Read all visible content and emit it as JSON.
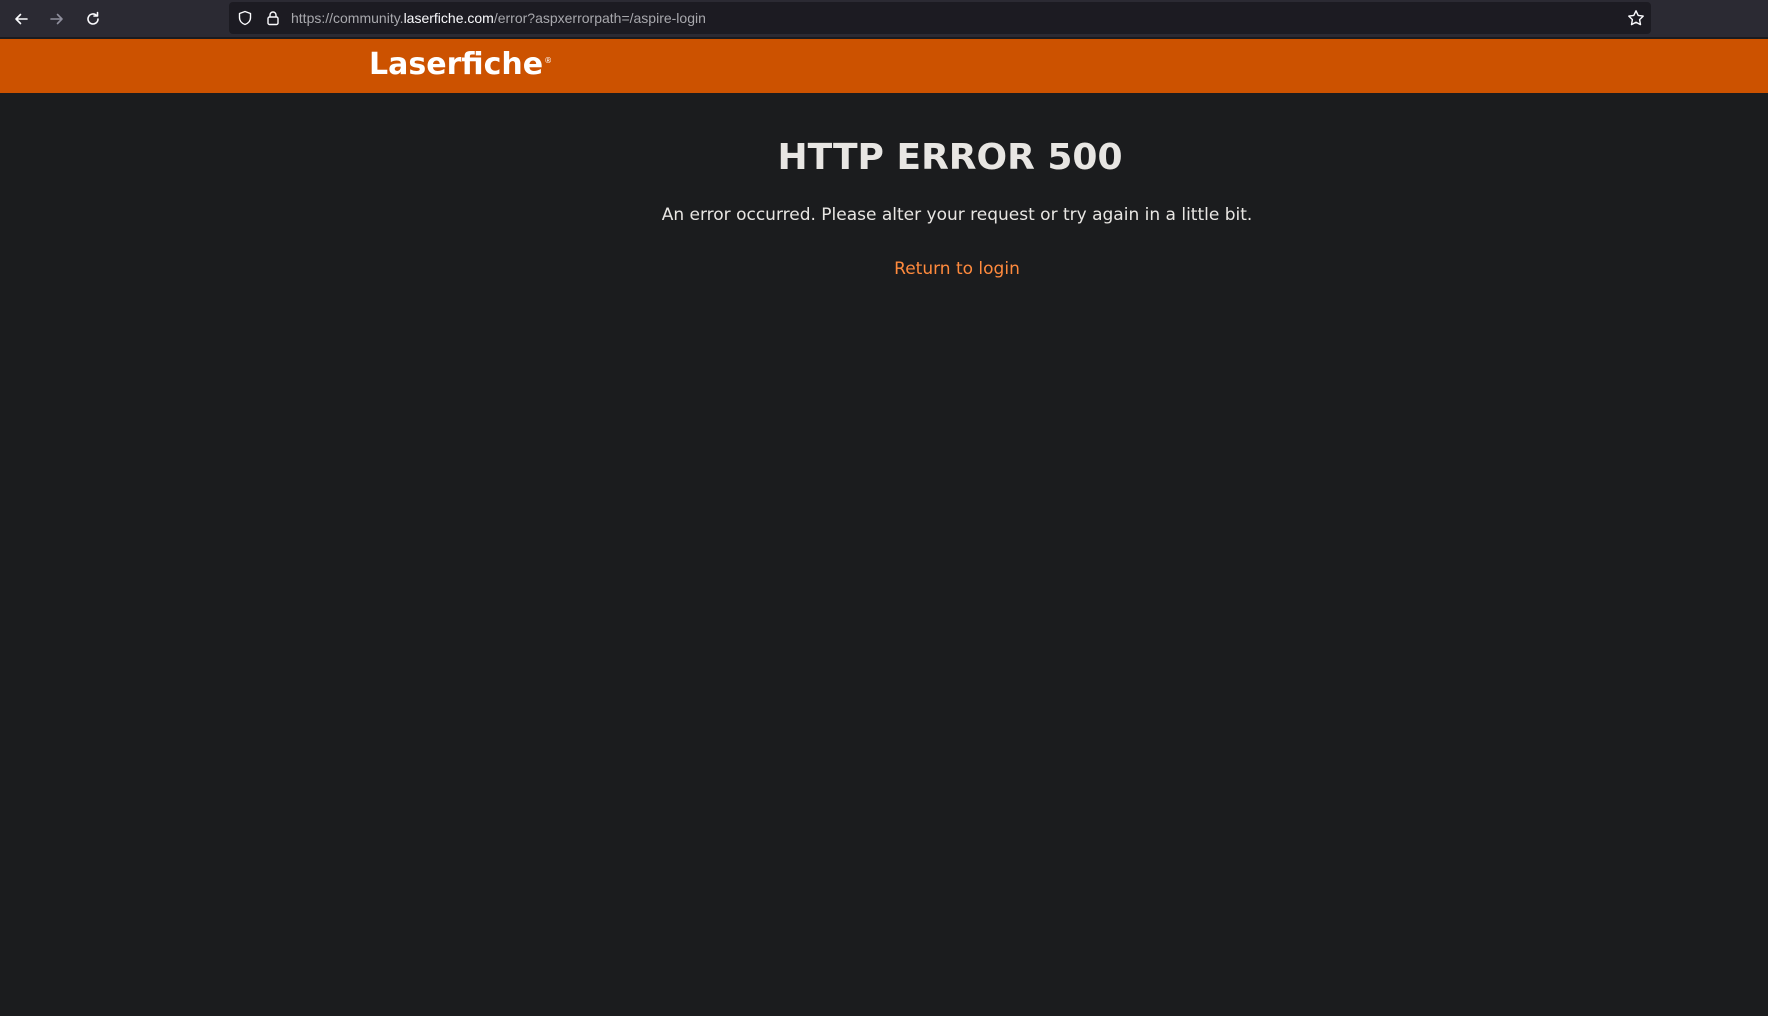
{
  "browser": {
    "url_prefix": "https://community.",
    "url_host": "laserfiche.com",
    "url_path": "/error?aspxerrorpath=/aspire-login",
    "icons": {
      "back": "arrow-left-icon",
      "forward": "arrow-right-icon",
      "reload": "reload-icon",
      "shield": "shield-icon",
      "lock": "lock-icon",
      "bookmark": "star-icon"
    }
  },
  "header": {
    "logo_text": "Laserfiche",
    "logo_mark": "®",
    "background_color": "#cc5200"
  },
  "main": {
    "title": "HTTP ERROR 500",
    "message": "An error occurred. Please alter your request or try again in a little bit.",
    "link_label": "Return to login",
    "link_color": "#ff8a3d"
  }
}
